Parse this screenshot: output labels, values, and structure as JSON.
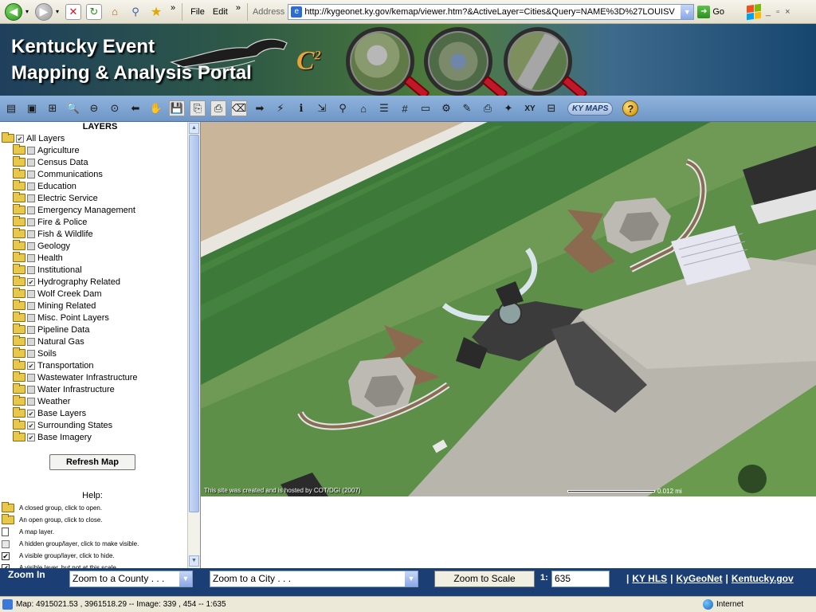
{
  "browser": {
    "menu": [
      "File",
      "Edit"
    ],
    "chevron": "»",
    "address_label": "Address",
    "address_url": "http://kygeonet.ky.gov/kemap/viewer.htm?&ActiveLayer=Cities&Query=NAME%3D%27LOUISV",
    "go_label": "Go",
    "window_controls": "_ ▫ ×"
  },
  "banner": {
    "title_line1": "Kentucky Event",
    "title_line2": "Mapping & Analysis Portal",
    "logo_text": "C",
    "logo_sup": "2"
  },
  "map_toolbar": {
    "tools": [
      {
        "name": "layer-list-icon",
        "glyph": "▤"
      },
      {
        "name": "legend-icon",
        "glyph": "▣"
      },
      {
        "name": "zoom-full-icon",
        "glyph": "⊞"
      },
      {
        "name": "zoom-in-icon",
        "glyph": "🔍"
      },
      {
        "name": "zoom-out-icon",
        "glyph": "⊖"
      },
      {
        "name": "zoom-prev-icon",
        "glyph": "⊙"
      },
      {
        "name": "back-arrow-icon",
        "glyph": "⬅"
      },
      {
        "name": "pan-hand-icon",
        "glyph": "✋"
      },
      {
        "name": "save-icon",
        "glyph": "💾"
      },
      {
        "name": "copy-icon",
        "glyph": "⎘"
      },
      {
        "name": "print-preview-icon",
        "glyph": "⎙"
      },
      {
        "name": "erase-icon",
        "glyph": "⌫"
      },
      {
        "name": "forward-arrow-icon",
        "glyph": "➡"
      },
      {
        "name": "lightning-icon",
        "glyph": "⚡"
      },
      {
        "name": "info-icon",
        "glyph": "ℹ"
      },
      {
        "name": "hyperlink-icon",
        "glyph": "⇲"
      },
      {
        "name": "binoculars-icon",
        "glyph": "⚲"
      },
      {
        "name": "select-icon",
        "glyph": "⌂"
      },
      {
        "name": "buffer-icon",
        "glyph": "☰"
      },
      {
        "name": "grid-icon",
        "glyph": "#"
      },
      {
        "name": "overview-icon",
        "glyph": "▭"
      },
      {
        "name": "measure-icon",
        "glyph": "⚙"
      },
      {
        "name": "draw-icon",
        "glyph": "✎"
      },
      {
        "name": "print-icon",
        "glyph": "⎙"
      },
      {
        "name": "clear-icon",
        "glyph": "✦"
      }
    ],
    "xy_label": "XY",
    "kymaps_label": "KY MAPS",
    "help_glyph": "?"
  },
  "layers": {
    "header": "LAYERS",
    "items": [
      {
        "label": "All Layers",
        "checked": true,
        "root": true
      },
      {
        "label": "Agriculture",
        "checked": false
      },
      {
        "label": "Census Data",
        "checked": false
      },
      {
        "label": "Communications",
        "checked": false
      },
      {
        "label": "Education",
        "checked": false
      },
      {
        "label": "Electric Service",
        "checked": false
      },
      {
        "label": "Emergency Management",
        "checked": false
      },
      {
        "label": "Fire & Police",
        "checked": false
      },
      {
        "label": "Fish & Wildlife",
        "checked": false
      },
      {
        "label": "Geology",
        "checked": false
      },
      {
        "label": "Health",
        "checked": false
      },
      {
        "label": "Institutional",
        "checked": false
      },
      {
        "label": "Hydrography Related",
        "checked": true
      },
      {
        "label": "Wolf Creek Dam",
        "checked": false
      },
      {
        "label": "Mining Related",
        "checked": false
      },
      {
        "label": "Misc. Point Layers",
        "checked": false
      },
      {
        "label": "Pipeline Data",
        "checked": false
      },
      {
        "label": "Natural Gas",
        "checked": false
      },
      {
        "label": "Soils",
        "checked": false
      },
      {
        "label": "Transportation",
        "checked": true
      },
      {
        "label": "Wastewater Infrastructure",
        "checked": false
      },
      {
        "label": "Water Infrastructure",
        "checked": false
      },
      {
        "label": "Weather",
        "checked": false
      },
      {
        "label": "Base Layers",
        "checked": true
      },
      {
        "label": "Surrounding States",
        "checked": true
      },
      {
        "label": "Base Imagery",
        "checked": true
      }
    ],
    "refresh_label": "Refresh Map",
    "help_title": "Help:",
    "help_items": [
      {
        "icon": "closed-folder",
        "text": "A closed group, click to open."
      },
      {
        "icon": "open-folder",
        "text": "An open group, click to close."
      },
      {
        "icon": "map-layer",
        "text": "A map layer."
      },
      {
        "icon": "hidden-box",
        "text": "A hidden group/layer, click to make visible."
      },
      {
        "icon": "visible-box",
        "text": "A visible group/layer, click to hide."
      },
      {
        "icon": "partial-box",
        "text": "A visible layer, but not at this scale."
      }
    ]
  },
  "map": {
    "credit": "This site was created and is hosted by COT/DGI (2007)",
    "scale_text": "0.012 mi"
  },
  "bottom_bar": {
    "zoom_in_label": "Zoom In",
    "county_select": "Zoom to a County . . .",
    "city_select": "Zoom to a City . . .",
    "zoom_scale_button": "Zoom to Scale",
    "scale_prefix": "1:",
    "scale_value": "635",
    "links": [
      "KY HLS",
      "KyGeoNet",
      "Kentucky.gov"
    ]
  },
  "status": {
    "text": "Map: 4915021.53 , 3961518.29 -- Image: 339 , 454 -- 1:635",
    "zone": "Internet"
  }
}
